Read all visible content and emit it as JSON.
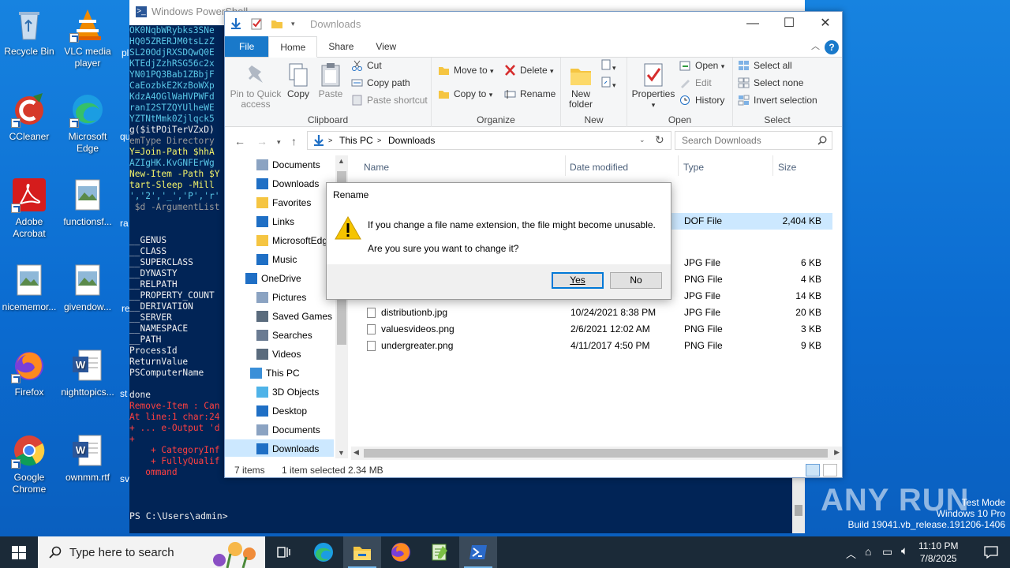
{
  "desktop": {
    "icons": [
      {
        "label": "Recycle Bin"
      },
      {
        "label": "VLC media player"
      },
      {
        "label": "CCleaner"
      },
      {
        "label": "Microsoft Edge"
      },
      {
        "label": "Adobe Acrobat"
      },
      {
        "label": "functionsf..."
      },
      {
        "label": "nicememor..."
      },
      {
        "label": "givendow..."
      },
      {
        "label": "Firefox"
      },
      {
        "label": "nighttopics..."
      },
      {
        "label": "Google Chrome"
      },
      {
        "label": "ownmm.rtf"
      }
    ],
    "partial_labels": [
      "pl",
      "qu",
      "ra",
      "re",
      "st",
      "sv"
    ]
  },
  "powershell": {
    "title": "Windows PowerShell",
    "lines": [
      {
        "text": "OK0NqbWRybks3SNe",
        "color": "cy"
      },
      {
        "text": "HQ05ZRERJM0tsLzZ",
        "color": "cy"
      },
      {
        "text": "SL20OdjRXSDQwQ0E",
        "color": "cy"
      },
      {
        "text": "KTEdjZzhRSG56c2x",
        "color": "cy"
      },
      {
        "text": "YN01PQ3Bab1ZBbjF",
        "color": "cy"
      },
      {
        "text": "CaEozbkE2KzBoWXp",
        "color": "cy"
      },
      {
        "text": "KdzA4OGlWaHVPWFd",
        "color": "cy"
      },
      {
        "text": "ranI2STZQYUlheWE",
        "color": "cy"
      },
      {
        "text": "YZTNtMmk0Zjlqck5",
        "color": "cy"
      },
      {
        "text": "g($itPOiTerVZxD)",
        "color": "wh"
      },
      {
        "text": "emType Directory",
        "color": "gr"
      },
      {
        "text": "Y=Join-Path $hhA",
        "color": "yl"
      },
      {
        "text": "AZIgHK.KvGNFErWg",
        "color": "cy"
      },
      {
        "text": "New-Item -Path $Y",
        "color": "yl"
      },
      {
        "text": "tart-Sleep -Mill",
        "color": "yl"
      },
      {
        "text": "','2','_','P','r'",
        "color": "cy"
      },
      {
        "text": " $d -ArgumentList",
        "color": "gr"
      },
      {
        "text": "",
        "color": "wh"
      },
      {
        "text": "",
        "color": "wh"
      },
      {
        "text": "__GENUS",
        "color": "wh"
      },
      {
        "text": "__CLASS",
        "color": "wh"
      },
      {
        "text": "__SUPERCLASS",
        "color": "wh"
      },
      {
        "text": "__DYNASTY",
        "color": "wh"
      },
      {
        "text": "__RELPATH",
        "color": "wh"
      },
      {
        "text": "__PROPERTY_COUNT",
        "color": "wh"
      },
      {
        "text": "__DERIVATION",
        "color": "wh"
      },
      {
        "text": "__SERVER",
        "color": "wh"
      },
      {
        "text": "__NAMESPACE",
        "color": "wh"
      },
      {
        "text": "__PATH",
        "color": "wh"
      },
      {
        "text": "ProcessId",
        "color": "wh"
      },
      {
        "text": "ReturnValue",
        "color": "wh"
      },
      {
        "text": "PSComputerName",
        "color": "wh"
      },
      {
        "text": "",
        "color": "wh"
      },
      {
        "text": "done",
        "color": "wh"
      },
      {
        "text": "Remove-Item : Can",
        "color": "rd"
      },
      {
        "text": "At line:1 char:24",
        "color": "rd"
      },
      {
        "text": "+ ... e-Output 'd",
        "color": "rd"
      },
      {
        "text": "+",
        "color": "rd"
      },
      {
        "text": "    + CategoryInf",
        "color": "rd"
      },
      {
        "text": "    + FullyQualif",
        "color": "rd"
      },
      {
        "text": "   ommand",
        "color": "rd"
      }
    ],
    "prompt": "PS C:\\Users\\admin>"
  },
  "explorer": {
    "title": "Downloads",
    "tabs": {
      "file": "File",
      "home": "Home",
      "share": "Share",
      "view": "View"
    },
    "help": "?",
    "clipboard": {
      "group": "Clipboard",
      "pin": "Pin to Quick access",
      "copy": "Copy",
      "paste": "Paste",
      "cut": "Cut",
      "copy_path": "Copy path",
      "paste_shortcut": "Paste shortcut"
    },
    "organize": {
      "group": "Organize",
      "move_to": "Move to",
      "copy_to": "Copy to",
      "delete": "Delete",
      "rename": "Rename"
    },
    "new": {
      "group": "New",
      "new_folder": "New folder"
    },
    "open": {
      "group": "Open",
      "properties": "Properties",
      "open": "Open",
      "edit": "Edit",
      "history": "History"
    },
    "select": {
      "group": "Select",
      "select_all": "Select all",
      "select_none": "Select none",
      "invert": "Invert selection"
    },
    "address": {
      "crumb1": "This PC",
      "crumb2": "Downloads"
    },
    "search_placeholder": "Search Downloads",
    "nav": [
      {
        "label": "Documents",
        "icon": "documents-icon"
      },
      {
        "label": "Downloads",
        "icon": "downloads-icon"
      },
      {
        "label": "Favorites",
        "icon": "favorites-icon"
      },
      {
        "label": "Links",
        "icon": "links-icon"
      },
      {
        "label": "MicrosoftEdge",
        "icon": "folder-icon"
      },
      {
        "label": "Music",
        "icon": "music-icon"
      },
      {
        "label": "OneDrive",
        "icon": "onedrive-icon"
      },
      {
        "label": "Pictures",
        "icon": "pictures-icon"
      },
      {
        "label": "Saved Games",
        "icon": "saved-games-icon"
      },
      {
        "label": "Searches",
        "icon": "searches-icon"
      },
      {
        "label": "Videos",
        "icon": "videos-icon"
      },
      {
        "label": "This PC",
        "icon": "this-pc-icon"
      },
      {
        "label": "3D Objects",
        "icon": "3d-objects-icon"
      },
      {
        "label": "Desktop",
        "icon": "desktop-icon"
      },
      {
        "label": "Documents",
        "icon": "documents-icon"
      },
      {
        "label": "Downloads",
        "icon": "downloads-icon"
      }
    ],
    "columns": {
      "name": "Name",
      "date": "Date modified",
      "type": "Type",
      "size": "Size"
    },
    "files": [
      {
        "name": "",
        "date": "",
        "type": "DOF File",
        "size": "2,404 KB",
        "selected": true
      },
      {
        "name": "",
        "date": "",
        "type": "JPG File",
        "size": "6 KB"
      },
      {
        "name": "",
        "date": "",
        "type": "PNG File",
        "size": "4 KB"
      },
      {
        "name": "",
        "date": "",
        "type": "JPG File",
        "size": "14 KB"
      },
      {
        "name": "distributionb.jpg",
        "date": "10/24/2021 8:38 PM",
        "type": "JPG File",
        "size": "20 KB"
      },
      {
        "name": "valuesvideos.png",
        "date": "2/6/2021 12:02 AM",
        "type": "PNG File",
        "size": "3 KB"
      },
      {
        "name": "undergreater.png",
        "date": "4/11/2017 4:50 PM",
        "type": "PNG File",
        "size": "9 KB"
      }
    ],
    "status": {
      "items": "7 items",
      "selected": "1 item selected",
      "size": "2.34 MB"
    }
  },
  "dialog": {
    "title": "Rename",
    "message1": "If you change a file name extension, the file might become unusable.",
    "message2": "Are you sure you want to change it?",
    "yes": "Yes",
    "no": "No"
  },
  "watermark": {
    "brand": "ANY RUN",
    "test_mode": "Test Mode",
    "os": "Windows 10 Pro",
    "build": "Build 19041.vb_release.191206-1406"
  },
  "taskbar": {
    "search_placeholder": "Type here to search",
    "time": "11:10 PM",
    "date": "7/8/2025"
  }
}
